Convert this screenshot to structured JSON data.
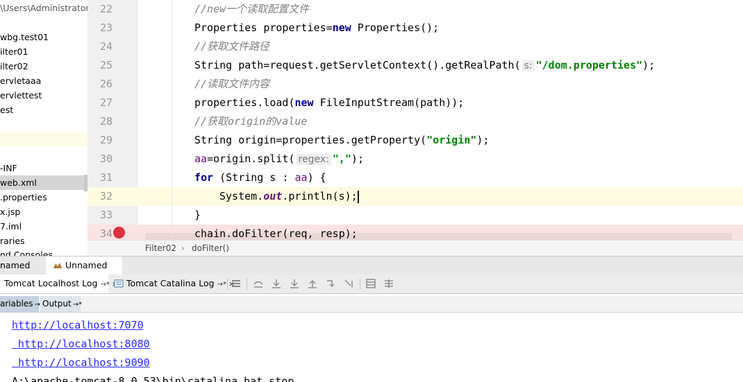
{
  "project": {
    "path": "\\Users\\Administrator\\",
    "items": [
      {
        "label": "wbg.test01"
      },
      {
        "label": "ilter01"
      },
      {
        "label": "ilter02"
      },
      {
        "label": "ervletaaa"
      },
      {
        "label": "ervlettest"
      },
      {
        "label": "est"
      },
      {
        "label": ""
      },
      {
        "label": "-INF"
      },
      {
        "label": "web.xml"
      },
      {
        "label": ".properties"
      },
      {
        "label": "x.jsp"
      },
      {
        "label": "7.iml"
      },
      {
        "label": "raries"
      },
      {
        "label": "nd Consoles"
      }
    ]
  },
  "editor": {
    "line_numbers": [
      "22",
      "23",
      "24",
      "25",
      "26",
      "27",
      "28",
      "29",
      "30",
      "31",
      "32",
      "33",
      "34"
    ],
    "lines": {
      "l22": "//new一个读取配置文件",
      "l23_a": "Properties properties=",
      "l23_kw": "new",
      "l23_b": " Properties();",
      "l24": "//获取文件路径",
      "l25_a": "String path=request.getServletContext().getRealPath(",
      "l25_hint": "s:",
      "l25_str": "\"/dom.properties\"",
      "l25_b": ");",
      "l26": "//读取文件内容",
      "l27_a": "properties.load(",
      "l27_kw": "new",
      "l27_b": " FileInputStream(path));",
      "l28": "//获取origin的value",
      "l29_a": "String origin=properties.getProperty(",
      "l29_str": "\"origin\"",
      "l29_b": ");",
      "l30_var": "aa",
      "l30_a": "=origin.split(",
      "l30_hint": "regex:",
      "l30_str": "\",\"",
      "l30_b": ");",
      "l31_kw": "for",
      "l31_a": " (String s : ",
      "l31_var": "aa",
      "l31_b": ") {",
      "l32_a": "System.",
      "l32_fld": "out",
      "l32_b": ".println(s);",
      "l33": "}",
      "l34": "chain.doFilter(req, resp);"
    }
  },
  "breadcrumb": {
    "class_name": "Filter02",
    "separator": "›",
    "method_name": "doFilter()"
  },
  "run_tabs": [
    {
      "label": "named"
    },
    {
      "label": "Unnamed"
    }
  ],
  "log_tabs": [
    {
      "label": "Tomcat Localhost Log",
      "pin": "→*",
      "close": "×"
    },
    {
      "label": "Tomcat Catalina Log",
      "pin": "→*",
      "close": "×"
    }
  ],
  "var_tabs": [
    {
      "label": "ariables",
      "pin": "→*"
    },
    {
      "label": "Output",
      "pin": "→*"
    }
  ],
  "console": {
    "lines": [
      "http://localhost:7070",
      " http://localhost:8080",
      " http://localhost:9090",
      "A:\\apache-tomcat-8.0.53\\bin\\catalina.bat stop"
    ]
  },
  "colors": {
    "breakpoint": "#e02f3e",
    "current_line": "#fffbe0",
    "breakpoint_line": "#fae3e3",
    "keyword": "#000080",
    "string": "#008000",
    "comment": "#808080",
    "link": "#2a2aff"
  }
}
